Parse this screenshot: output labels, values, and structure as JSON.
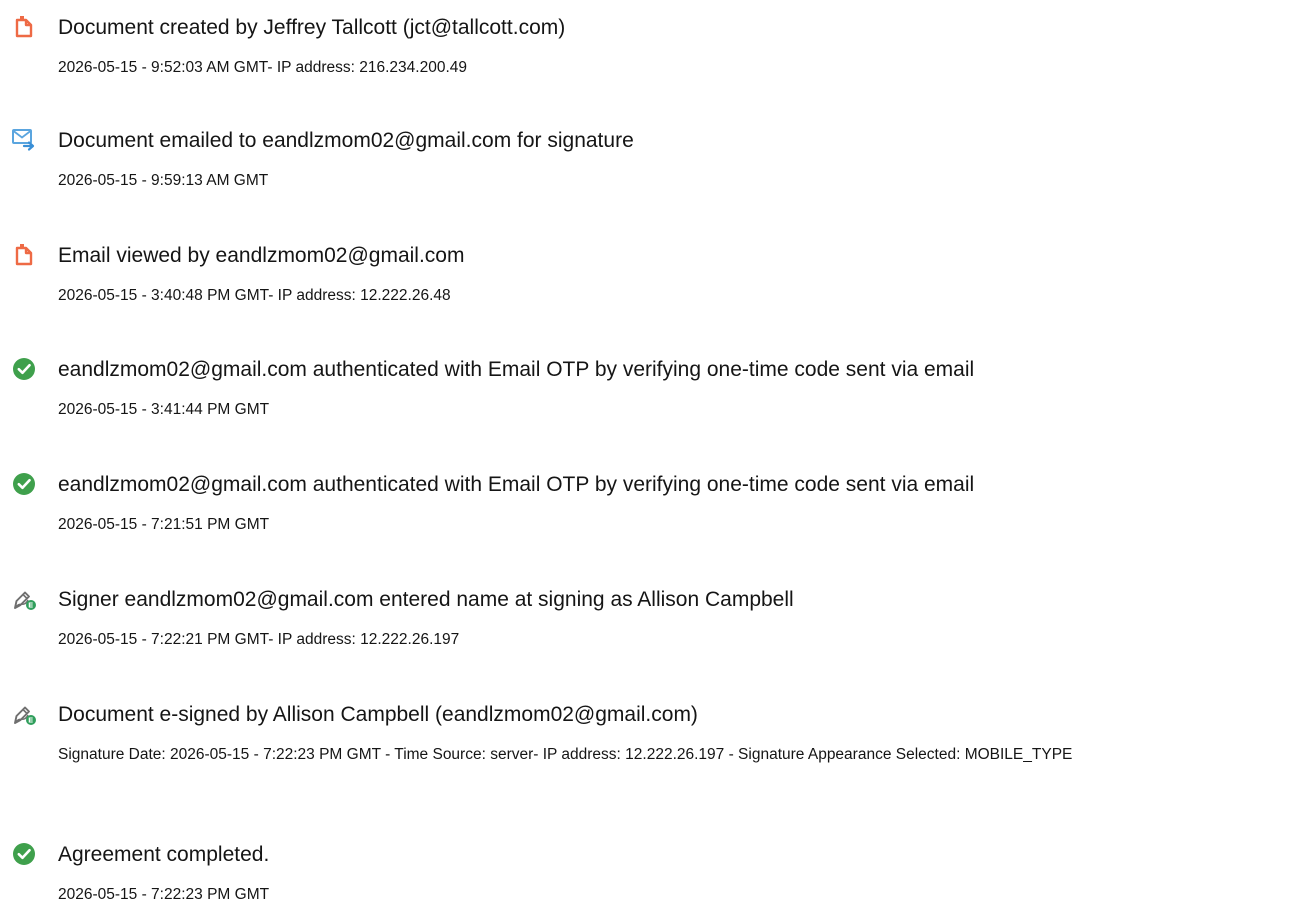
{
  "icon_colors": {
    "document": "#ee6a45",
    "email": "#5aa5df",
    "check": "#3fa04c",
    "signature": "#6f6f6f",
    "signature_badge": "#2f9e5b"
  },
  "events": [
    {
      "icon": "document-icon",
      "title": "Document created by Jeffrey Tallcott (jct@tallcott.com)",
      "detail": "2026-05-15 - 9:52:03 AM GMT- IP address: 216.234.200.49"
    },
    {
      "icon": "email-send-icon",
      "title": "Document emailed to eandlzmom02@gmail.com for signature",
      "detail": "2026-05-15 - 9:59:13 AM GMT"
    },
    {
      "icon": "document-icon",
      "title": "Email viewed by eandlzmom02@gmail.com",
      "detail": "2026-05-15 - 3:40:48 PM GMT- IP address: 12.222.26.48"
    },
    {
      "icon": "check-circle-icon",
      "title": "eandlzmom02@gmail.com authenticated with Email OTP by verifying one-time code sent via email",
      "detail": "2026-05-15 - 3:41:44 PM GMT"
    },
    {
      "icon": "check-circle-icon",
      "title": "eandlzmom02@gmail.com authenticated with Email OTP by verifying one-time code sent via email",
      "detail": "2026-05-15 - 7:21:51 PM GMT"
    },
    {
      "icon": "signature-pen-icon",
      "title": "Signer eandlzmom02@gmail.com entered name at signing as Allison Campbell",
      "detail": "2026-05-15 - 7:22:21 PM GMT- IP address: 12.222.26.197"
    },
    {
      "icon": "signature-pen-icon",
      "title": "Document e-signed by Allison Campbell (eandlzmom02@gmail.com)",
      "detail": "Signature Date: 2026-05-15 - 7:22:23 PM GMT - Time Source: server- IP address: 12.222.26.197 - Signature Appearance Selected: MOBILE_TYPE"
    },
    {
      "icon": "check-circle-icon",
      "title": "Agreement completed.",
      "detail": "2026-05-15 - 7:22:23 PM GMT"
    }
  ]
}
